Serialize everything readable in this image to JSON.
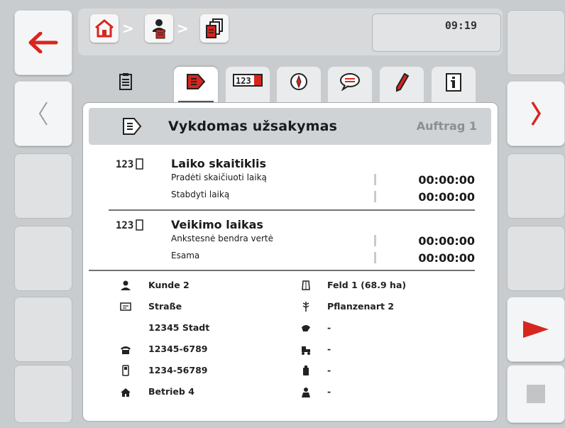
{
  "header": {
    "clock": "09:19",
    "breadcrumb": [
      "home-icon",
      "operator-icon",
      "documents-icon"
    ]
  },
  "tabs": [
    {
      "name": "tab-overview",
      "icon": "clipboard-icon",
      "active": false
    },
    {
      "name": "tab-current-task",
      "icon": "task-play-icon",
      "active": true
    },
    {
      "name": "tab-counters",
      "icon": "counter-123-icon",
      "active": false
    },
    {
      "name": "tab-navigation",
      "icon": "compass-icon",
      "active": false
    },
    {
      "name": "tab-comments",
      "icon": "speech-bubble-icon",
      "active": false
    },
    {
      "name": "tab-edit",
      "icon": "pencil-icon",
      "active": false
    },
    {
      "name": "tab-info",
      "icon": "info-icon",
      "active": false
    }
  ],
  "panel": {
    "title": "Vykdomas užsakymas",
    "subtitle": "Auftrag 1",
    "sections": [
      {
        "title": "Laiko skaitiklis",
        "rows": [
          {
            "label": "Pradėti skaičiuoti laiką",
            "value": "00:00:00"
          },
          {
            "label": "Stabdyti laiką",
            "value": "00:00:00"
          }
        ]
      },
      {
        "title": "Veikimo laikas",
        "rows": [
          {
            "label": "Ankstesnė bendra vertė",
            "value": "00:00:00"
          },
          {
            "label": "Esama",
            "value": "00:00:00"
          }
        ]
      }
    ],
    "left_info": [
      {
        "icon": "customer-icon",
        "text": "Kunde 2"
      },
      {
        "icon": "address-icon",
        "text": "Straße"
      },
      {
        "icon": "",
        "text": "12345 Stadt"
      },
      {
        "icon": "phone-icon",
        "text": "12345-6789"
      },
      {
        "icon": "mobile-icon",
        "text": "1234-56789"
      },
      {
        "icon": "farm-icon",
        "text": "Betrieb 4"
      }
    ],
    "right_info": [
      {
        "icon": "field-icon",
        "text": "Feld 1 (68.9 ha)"
      },
      {
        "icon": "crop-icon",
        "text": "Pflanzenart 2"
      },
      {
        "icon": "fertilizer-icon",
        "text": "-"
      },
      {
        "icon": "machine-icon",
        "text": "-"
      },
      {
        "icon": "product-icon",
        "text": "-"
      },
      {
        "icon": "worker-icon",
        "text": "-"
      }
    ]
  },
  "colors": {
    "accent_red": "#d7261e",
    "frame_grey": "#c9ccce",
    "header_grey": "#cfd3d6"
  }
}
